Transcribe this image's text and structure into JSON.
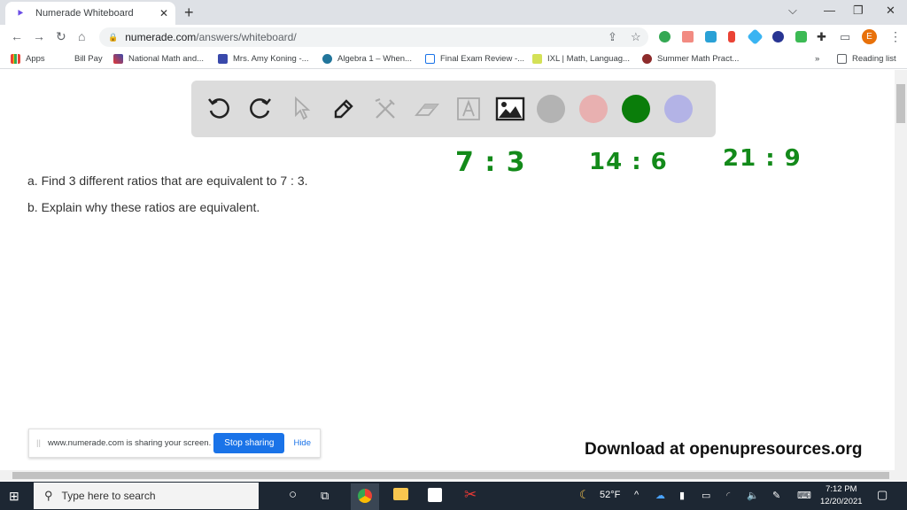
{
  "browser": {
    "tab_title": "Numerade Whiteboard",
    "url_domain": "numerade.com",
    "url_path": "/answers/whiteboard/",
    "avatar_initial": "E",
    "bookmarks": [
      {
        "label": "Apps"
      },
      {
        "label": "Bill Pay"
      },
      {
        "label": "National Math and..."
      },
      {
        "label": "Mrs. Amy Koning -..."
      },
      {
        "label": "Algebra 1 – When..."
      },
      {
        "label": "Final Exam Review -..."
      },
      {
        "label": "IXL | Math, Languag..."
      },
      {
        "label": "Summer Math Pract..."
      }
    ],
    "more_bookmarks": "»",
    "reading_list": "Reading list"
  },
  "whiteboard": {
    "tools": [
      "undo",
      "redo",
      "select",
      "pen",
      "tools",
      "eraser",
      "text",
      "image"
    ],
    "colors": [
      "#b3b3b3",
      "#e8b0b0",
      "#0a7d0a",
      "#b3b3e6"
    ],
    "selected_color": "#0a7d0a"
  },
  "problem": {
    "part_a": "a. Find 3 different ratios that are equivalent to 7 : 3.",
    "part_b": "b. Explain why these ratios are equivalent."
  },
  "handwriting": {
    "ratio1": "7 : 3",
    "ratio2": "14 : 6",
    "ratio3": "21 : 9"
  },
  "share_bar": {
    "message": "www.numerade.com is sharing your screen.",
    "stop_label": "Stop sharing",
    "hide_label": "Hide"
  },
  "watermark": "Download at openupresources.org",
  "taskbar": {
    "search_placeholder": "Type here to search",
    "weather": "52°F",
    "time": "7:12 PM",
    "date": "12/20/2021"
  }
}
